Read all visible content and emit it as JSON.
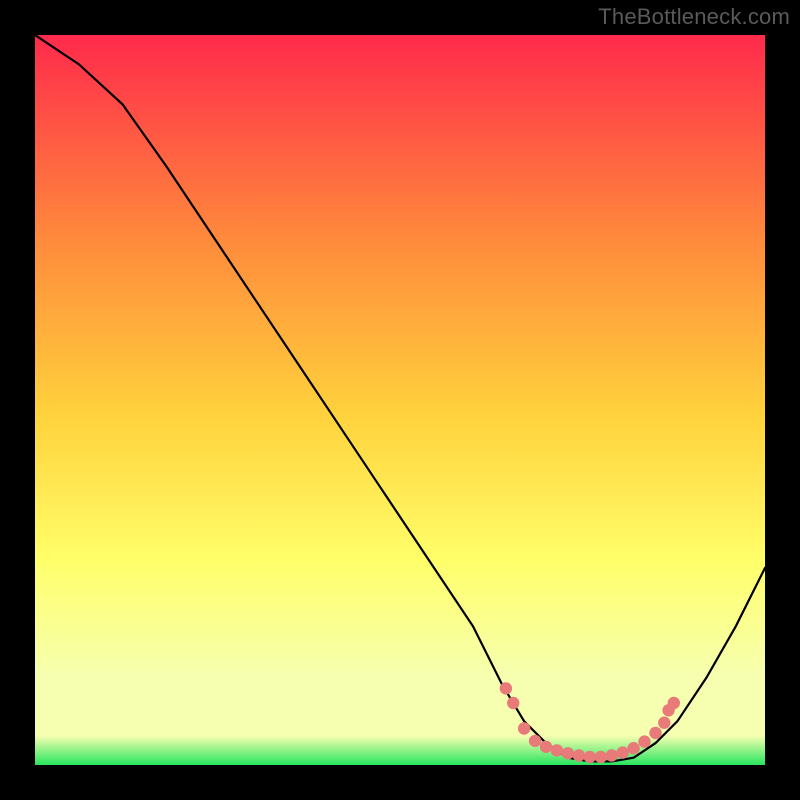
{
  "watermark": "TheBottleneck.com",
  "chart_data": {
    "type": "line",
    "title": "",
    "xlabel": "",
    "ylabel": "",
    "xlim": [
      0,
      100
    ],
    "ylim": [
      0,
      100
    ],
    "grid": false,
    "legend": false,
    "background_gradient": {
      "top": "#ff2a4b",
      "upper_mid": "#ff8a3c",
      "mid": "#ffd23c",
      "lower_mid": "#ffff6a",
      "lower": "#f6ffb0",
      "bottom": "#27e55f"
    },
    "series": [
      {
        "name": "bottleneck-curve",
        "color": "#000000",
        "x": [
          0,
          6,
          12,
          18,
          24,
          30,
          36,
          42,
          48,
          54,
          60,
          64,
          67,
          70,
          73,
          76,
          79,
          82,
          85,
          88,
          92,
          96,
          100
        ],
        "y": [
          100,
          96,
          90.5,
          82,
          73,
          64,
          55,
          46,
          37,
          28,
          19,
          11,
          6,
          3,
          1,
          0.5,
          0.5,
          1,
          3,
          6,
          12,
          19,
          27
        ]
      }
    ],
    "markers": {
      "name": "optimal-zone",
      "color": "#e87a7a",
      "points": [
        {
          "x": 64.5,
          "y": 10.5
        },
        {
          "x": 65.5,
          "y": 8.5
        },
        {
          "x": 67.0,
          "y": 5.0
        },
        {
          "x": 68.5,
          "y": 3.3
        },
        {
          "x": 70.0,
          "y": 2.5
        },
        {
          "x": 71.5,
          "y": 2.0
        },
        {
          "x": 73.0,
          "y": 1.6
        },
        {
          "x": 74.5,
          "y": 1.3
        },
        {
          "x": 76.0,
          "y": 1.1
        },
        {
          "x": 77.5,
          "y": 1.1
        },
        {
          "x": 79.0,
          "y": 1.3
        },
        {
          "x": 80.5,
          "y": 1.7
        },
        {
          "x": 82.0,
          "y": 2.3
        },
        {
          "x": 83.5,
          "y": 3.2
        },
        {
          "x": 85.0,
          "y": 4.4
        },
        {
          "x": 86.2,
          "y": 5.8
        },
        {
          "x": 86.8,
          "y": 7.5
        },
        {
          "x": 87.5,
          "y": 8.5
        }
      ]
    }
  }
}
